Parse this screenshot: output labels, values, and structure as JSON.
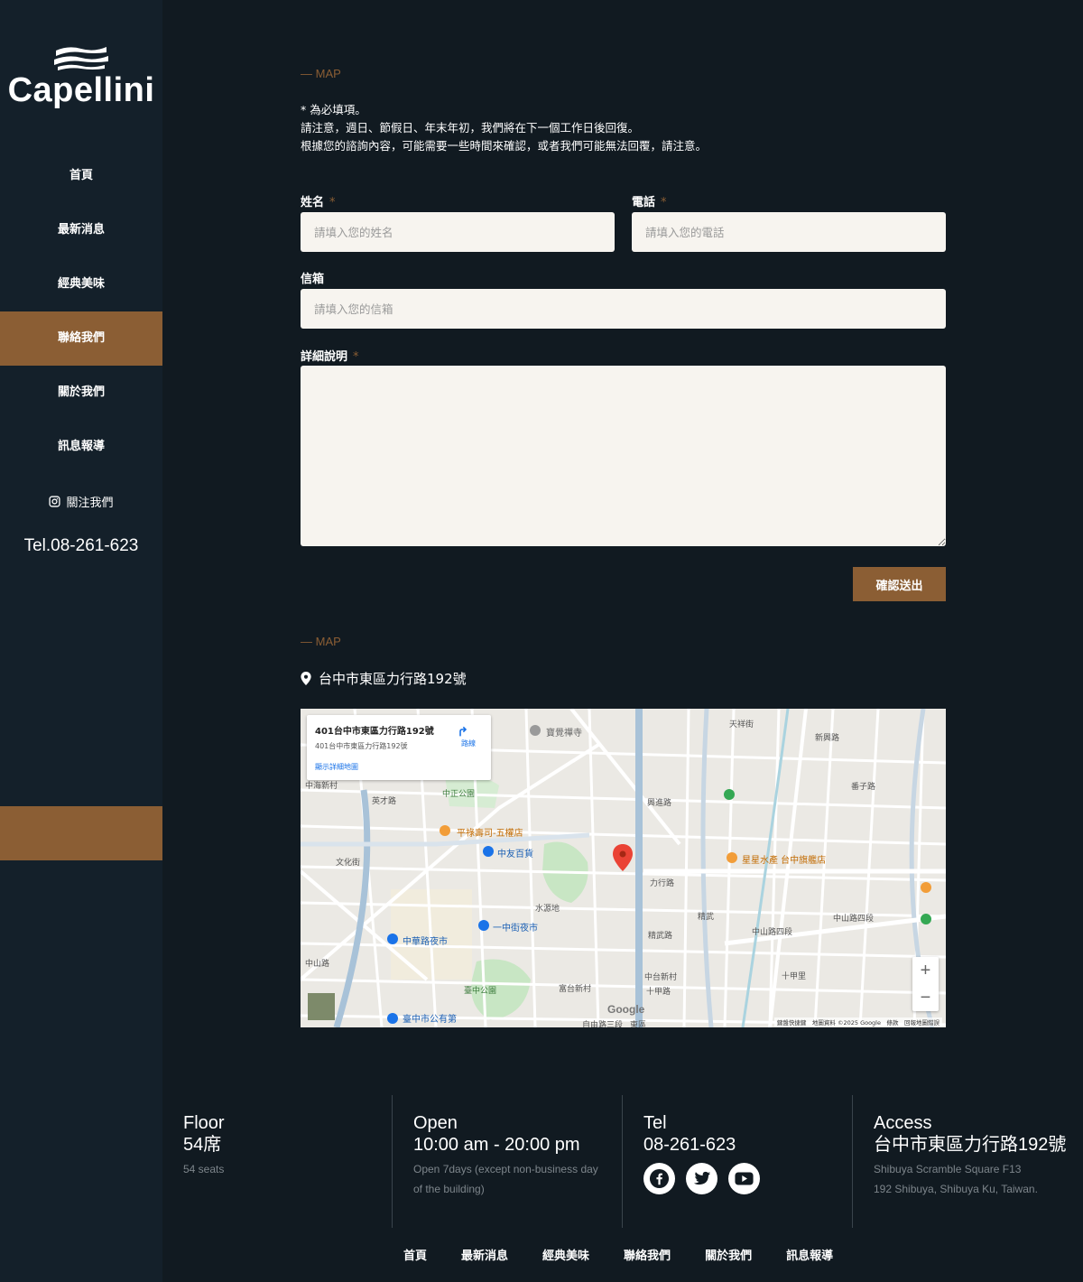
{
  "brand": {
    "name": "Capellini"
  },
  "nav": {
    "items": [
      {
        "label": "首頁"
      },
      {
        "label": "最新消息"
      },
      {
        "label": "經典美味"
      },
      {
        "label": "聯絡我們"
      },
      {
        "label": "關於我們"
      },
      {
        "label": "訊息報導"
      }
    ],
    "active_index": 3,
    "instagram_label": "關注我們",
    "tel": "Tel.08-261-623"
  },
  "form": {
    "section_tag": "— MAP",
    "notes": [
      "* 為必填項。",
      "請注意，週日、節假日、年末年初，我們將在下一個工作日後回復。",
      "根據您的諮詢內容，可能需要一些時間來確認，或者我們可能無法回覆，請注意。"
    ],
    "name_label": "姓名",
    "name_placeholder": "請填入您的姓名",
    "phone_label": "電話",
    "phone_placeholder": "請填入您的電話",
    "email_label": "信箱",
    "email_placeholder": "請填入您的信箱",
    "detail_label": "詳細說明",
    "required_mark": "*",
    "submit_label": "確認送出"
  },
  "map_section": {
    "section_tag": "— MAP",
    "address": "台中市東區力行路192號",
    "card_title": "401台中市東區力行路192號",
    "card_subtitle": "401台中市東區力行路192號",
    "card_link": "顯示詳細地圖",
    "directions_label": "路線",
    "zoom_in": "+",
    "zoom_out": "−",
    "attribution": "鍵盤快捷鍵　地圖資料 ©2025 Google　條款　回報地圖錯誤",
    "google": "Google",
    "labels": {
      "l1": "寶覺禪寺",
      "l2": "中正公園",
      "l3": "平祿壽司-五權店",
      "l4": "中友百貨",
      "l5": "星星水產 台中旗艦店",
      "l6": "中華路夜市",
      "l7": "一中街夜市",
      "l8": "臺中公園",
      "l9": "臺中市公有第",
      "l10": "中海新村",
      "l11": "英才路",
      "l12": "文化街",
      "l13": "力行路",
      "l14": "精武路",
      "l15": "中台新村",
      "l16": "十甲路",
      "l17": "水源地",
      "l18": "富台新村",
      "l19": "中山路四段",
      "l20": "十甲里",
      "l21": "天祥街",
      "l22": "新興路",
      "l23": "番子路",
      "l24": "興進路",
      "l25": "精武",
      "l26": "中山路",
      "l27": "自由路三段",
      "l28": "東區",
      "l29": "中山路四段"
    }
  },
  "footer": {
    "floor_title": "Floor",
    "floor_value": "54席",
    "floor_sub": "54 seats",
    "open_title": "Open",
    "open_value": "10:00 am - 20:00 pm",
    "open_sub": "Open 7days (except non-business day of the building)",
    "tel_title": "Tel",
    "tel_value": "08-261-623",
    "access_title": "Access",
    "access_value": "台中市東區力行路192號",
    "access_sub1": "Shibuya Scramble Square F13",
    "access_sub2": "192 Shibuya, Shibuya Ku, Taiwan.",
    "social": [
      "facebook-icon",
      "twitter-icon",
      "youtube-icon"
    ],
    "nav": [
      "首頁",
      "最新消息",
      "經典美味",
      "聯絡我們",
      "關於我們",
      "訊息報導"
    ]
  },
  "colors": {
    "accent": "#8b5e34",
    "background": "#111a21",
    "sidebar": "#14202a",
    "input_bg": "#f7f4ef"
  }
}
